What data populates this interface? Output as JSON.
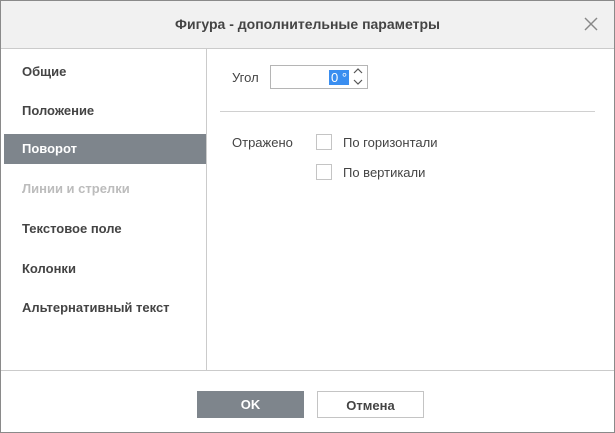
{
  "dialog": {
    "title": "Фигура - дополнительные параметры",
    "close_icon": "close-x-icon"
  },
  "sidebar": {
    "items": [
      {
        "label": "Общие",
        "state": "normal"
      },
      {
        "label": "Положение",
        "state": "normal"
      },
      {
        "label": "Поворот",
        "state": "active"
      },
      {
        "label": "Линии и стрелки",
        "state": "disabled"
      },
      {
        "label": "Текстовое поле",
        "state": "normal"
      },
      {
        "label": "Колонки",
        "state": "normal"
      },
      {
        "label": "Альтернативный текст",
        "state": "normal"
      }
    ]
  },
  "rotation": {
    "angle_label": "Угол",
    "angle_value": "0 °",
    "flip_label": "Отражено",
    "horizontal_label": "По горизонтали",
    "horizontal_checked": false,
    "vertical_label": "По вертикали",
    "vertical_checked": false
  },
  "footer": {
    "ok_label": "OK",
    "cancel_label": "Отмена"
  },
  "colors": {
    "accent": "#7e858c",
    "selection": "#3a8ef0",
    "titlebar": "#f1f1f1"
  }
}
